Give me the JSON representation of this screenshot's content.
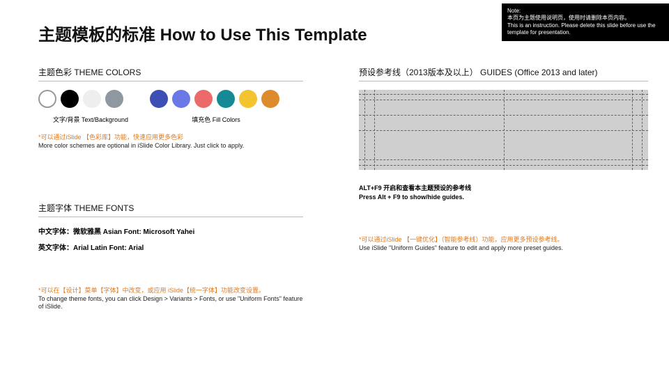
{
  "note": {
    "title": "Note:",
    "line1_zh": "本页为主题使用说明页，使用时请删除本页内容。",
    "line2_en": "This is an instruction. Please delete this slide before use the template for presentation."
  },
  "title": "主题模板的标准 How to Use This Template",
  "colors": {
    "heading": "主题色彩 THEME COLORS",
    "text_bg_label": "文字/背景 Text/Background",
    "fill_label": "填充色 Fill Colors",
    "swatches_text": [
      "#ffffff",
      "#000000",
      "#eeeeee",
      "#8f98a1"
    ],
    "swatches_fill": [
      "#3d4fb5",
      "#6b79e6",
      "#ed6a6a",
      "#158a94",
      "#f4c430",
      "#dd8b2d"
    ],
    "tip_accent": "*可以通过iSlide 【色彩库】功能，快速应用更多色彩",
    "tip_sub": "More color schemes are optional in iSlide Color Library. Just click to apply."
  },
  "fonts": {
    "heading": "主题字体 THEME FONTS",
    "asian": "中文字体：微软雅黑  Asian Font: Microsoft Yahei",
    "latin": "英文字体：Arial  Latin Font: Arial",
    "tip_accent": "*可以在【设计】菜单【字体】中改变，或应用 iSlide【统一字体】功能改变设置。",
    "tip_sub": "To change theme fonts, you can click Design > Variants > Fonts, or use \"Uniform Fonts\" feature of iSlide."
  },
  "guides": {
    "heading": "预设参考线（2013版本及以上） GUIDES (Office 2013 and later)",
    "alt1": "ALT+F9 开启和查看本主题预设的参考线",
    "alt2": "Press Alt + F9 to show/hide guides.",
    "tip_accent": "*可以通过iSlide 【一键优化】（智能参考线）功能，应用更多预设参考线。",
    "tip_sub": "Use iSlide \"Uniform Guides\" feature to edit and apply more preset guides."
  }
}
